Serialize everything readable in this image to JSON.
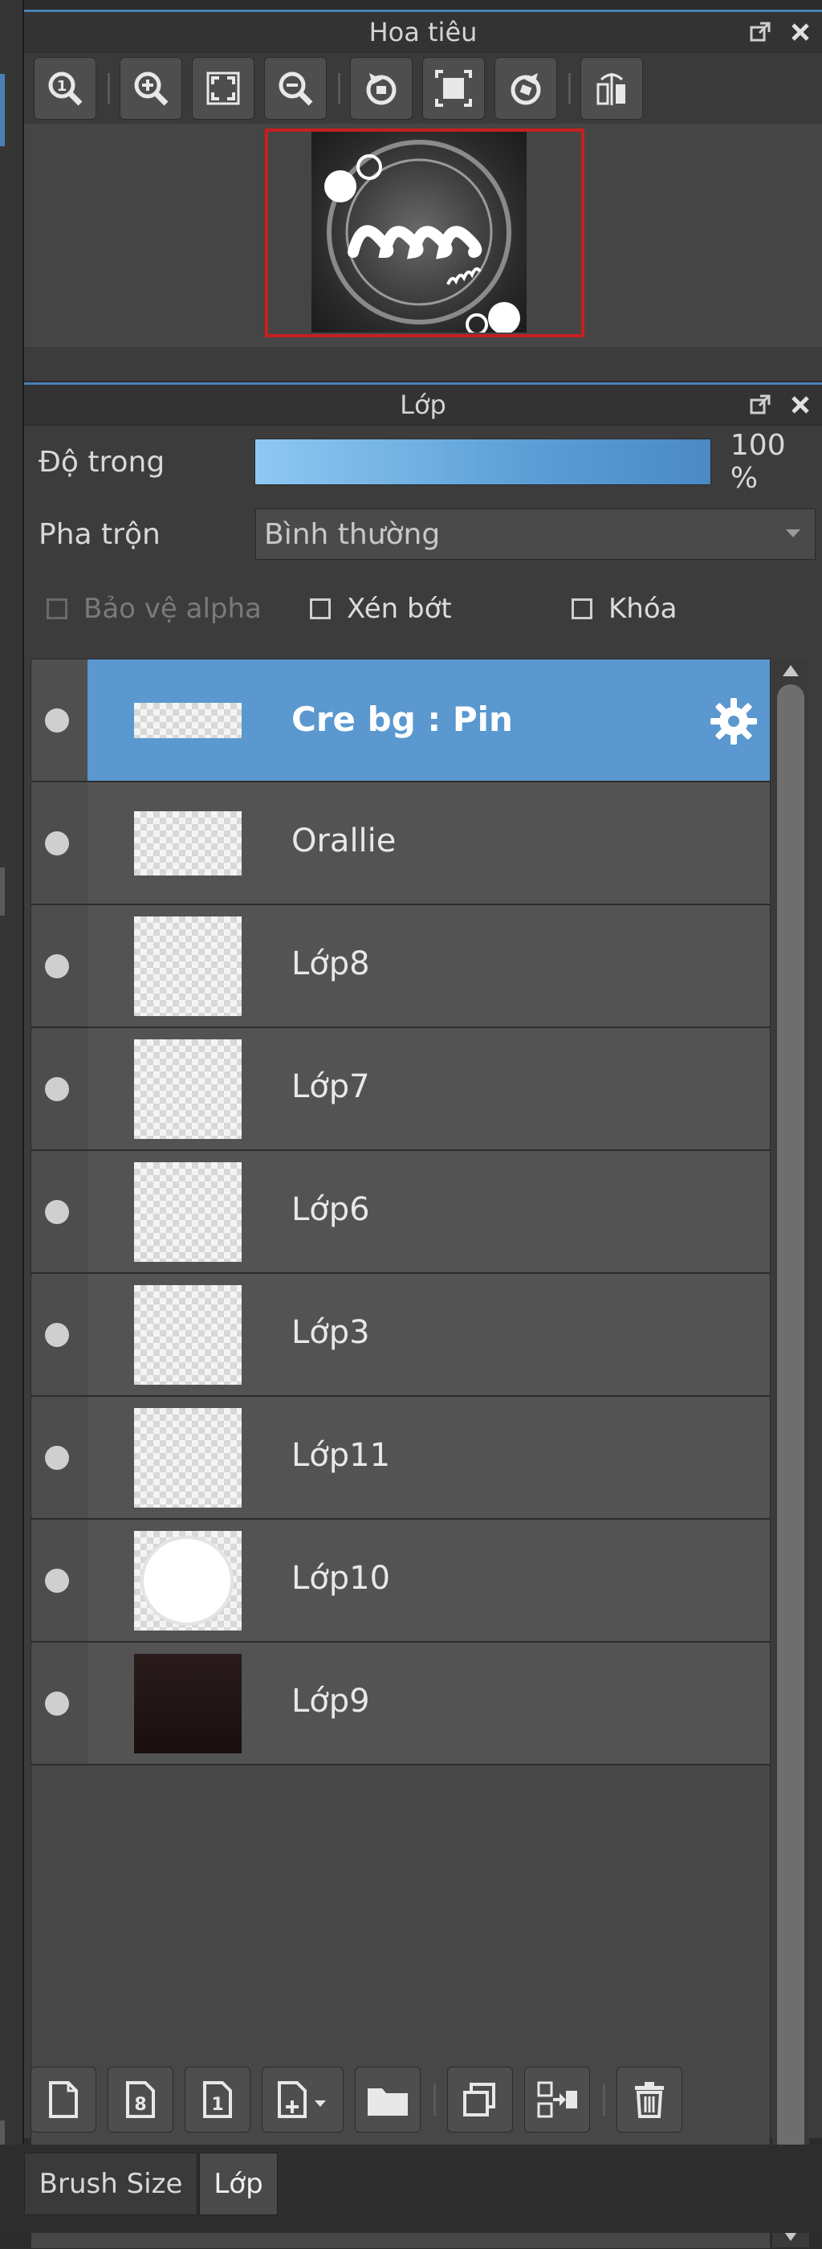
{
  "navigator": {
    "title": "Hoa tiêu",
    "toolbar": [
      "zoom-fit-icon",
      "zoom-in-icon",
      "fit-screen-icon",
      "zoom-out-icon",
      "rotate-left-icon",
      "actual-size-icon",
      "rotate-right-icon",
      "flip-horizontal-icon"
    ]
  },
  "layers_panel": {
    "title": "Lớp",
    "opacity_label": "Độ trong",
    "opacity_value": "100 %",
    "opacity_level": 1.0,
    "blend_label": "Pha trộn",
    "blend_value": "Bình thường",
    "checks": {
      "protect_alpha": "Bảo vệ alpha",
      "clipping": "Xén bớt",
      "lock": "Khóa"
    },
    "layers": [
      {
        "name": "Cre bg : Pin",
        "active": true
      },
      {
        "name": "Orallie",
        "active": false
      },
      {
        "name": "Lớp8",
        "active": false
      },
      {
        "name": "Lớp7",
        "active": false
      },
      {
        "name": "Lớp6",
        "active": false
      },
      {
        "name": "Lớp3",
        "active": false
      },
      {
        "name": "Lớp11",
        "active": false
      },
      {
        "name": "Lớp10",
        "active": false
      },
      {
        "name": "Lớp9",
        "active": false
      }
    ]
  },
  "tabs": {
    "brush_size": "Brush Size",
    "layer": "Lớp"
  },
  "colors": {
    "accent": "#4a7fb5",
    "active_layer": "#5a98cf",
    "frame": "#c71f1f"
  }
}
